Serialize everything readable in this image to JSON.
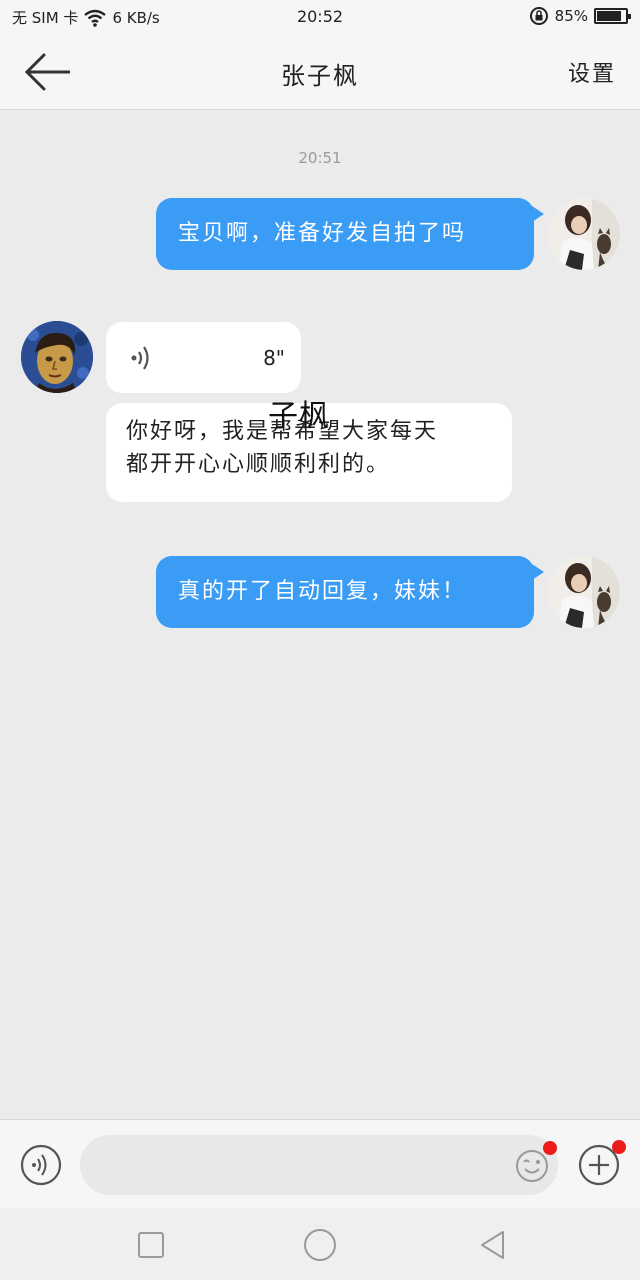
{
  "status_bar": {
    "sim": "无 SIM 卡",
    "speed": "6 KB/s",
    "time": "20:52",
    "battery": "85%",
    "battery_level": 0.85
  },
  "header": {
    "title": "张子枫",
    "settings_label": "设置"
  },
  "chat": {
    "timestamp": "20:51",
    "messages": [
      {
        "from": "me",
        "text": "宝贝啊，准备好发自拍了吗"
      },
      {
        "from": "friend",
        "type": "voice",
        "duration": "8\""
      },
      {
        "from": "friend",
        "text_line1": "你好呀，我是帮希望大家每天",
        "text_line2": "都开开心心顺顺利利的。"
      },
      {
        "from": "me",
        "text": "真的开了自动回复，妹妹！"
      }
    ],
    "overlay": "子枫"
  },
  "input": {
    "placeholder": ""
  },
  "colors": {
    "outgoing_bubble": "#3a9cf5",
    "badge": "#ee1b1b"
  },
  "icons": [
    "back-arrow-icon",
    "voice-icon",
    "emoji-icon",
    "plus-icon",
    "square-icon",
    "circle-icon",
    "triangle-back-icon",
    "wifi-icon",
    "lock-rotation-icon"
  ]
}
